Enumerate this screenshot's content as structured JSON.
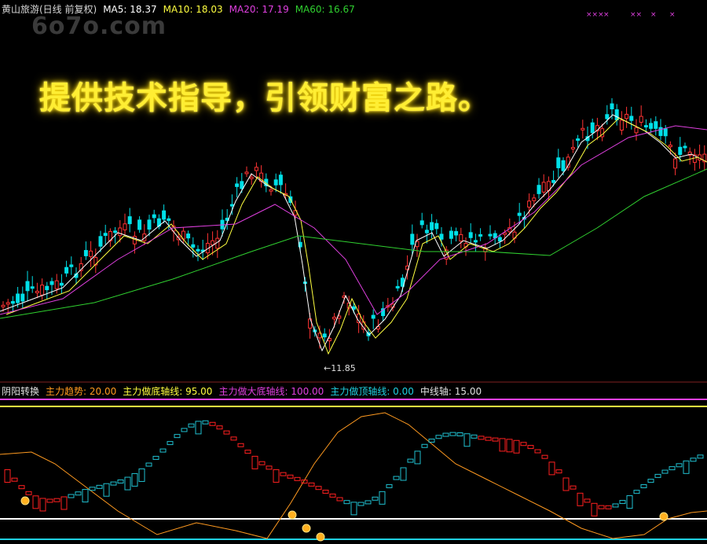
{
  "header": {
    "title": "黄山旅游(日线 前复权)",
    "ma5": "MA5: 18.37",
    "ma10": "MA10: 18.03",
    "ma20": "MA20: 17.19",
    "ma60": "MA60: 16.67"
  },
  "watermark": "6o7o.com",
  "caption": "提供技术指导，引领财富之路。",
  "x_marks": [
    "×××",
    "×",
    "××",
    "×",
    "×"
  ],
  "low_label": "←11.85",
  "indicator": {
    "name": "阴阳转换",
    "trend": "主力趋势: 20.00",
    "bottom_axis": "主力做底轴线: 95.00",
    "big_bottom_axis": "主力做大底轴线: 100.00",
    "top_axis": "主力做顶轴线: 0.00",
    "mid_axis": "中线轴: 15.00"
  },
  "colors": {
    "up": "#ff3333",
    "down": "#00e0e8",
    "ma5": "#ffffff",
    "ma10": "#ffff40",
    "ma20": "#e040e0",
    "ma60": "#30d030",
    "trend": "#ff9a20",
    "box_up": "#ff2020",
    "box_down": "#20c0d0"
  }
}
